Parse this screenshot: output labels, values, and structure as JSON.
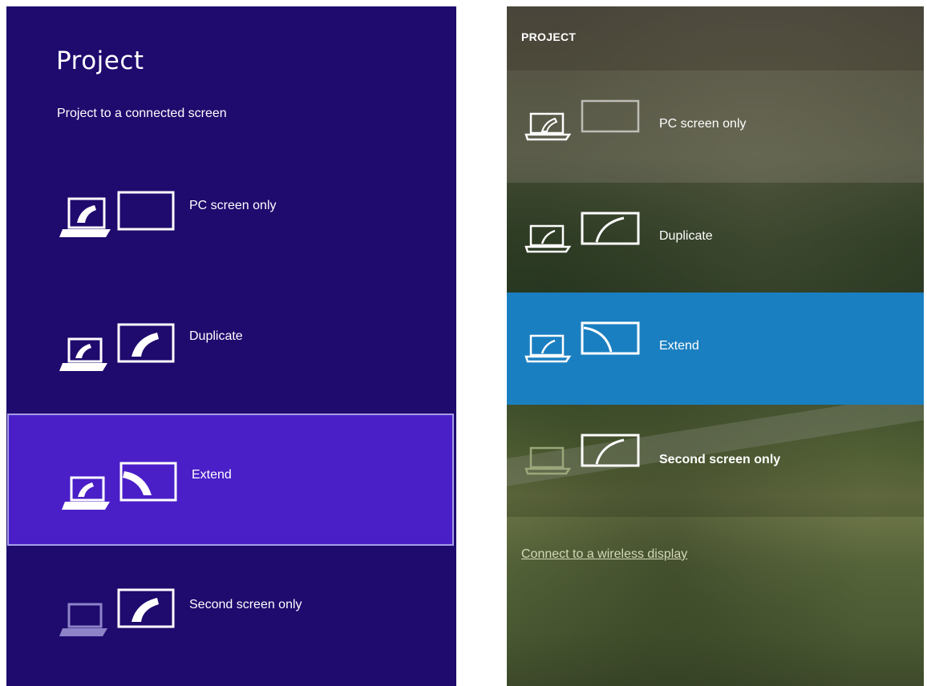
{
  "left_panel": {
    "title": "Project",
    "subtitle": "Project to a connected screen",
    "options": [
      {
        "label": "PC screen only",
        "icon": "pc-screen-only-icon",
        "selected": false
      },
      {
        "label": "Duplicate",
        "icon": "duplicate-icon",
        "selected": false
      },
      {
        "label": "Extend",
        "icon": "extend-icon",
        "selected": true
      },
      {
        "label": "Second screen only",
        "icon": "second-screen-only-icon",
        "selected": false
      }
    ],
    "colors": {
      "background": "#1f0a6e",
      "selected": "#4a1fc8"
    }
  },
  "right_panel": {
    "title": "PROJECT",
    "options": [
      {
        "label": "PC screen only",
        "icon": "pc-screen-only-icon",
        "selected": false
      },
      {
        "label": "Duplicate",
        "icon": "duplicate-icon",
        "selected": false
      },
      {
        "label": "Extend",
        "icon": "extend-icon",
        "selected": true
      },
      {
        "label": "Second screen only",
        "icon": "second-screen-only-icon",
        "selected": false
      }
    ],
    "link": "Connect to a wireless display",
    "colors": {
      "selected": "#1a7fc1"
    }
  }
}
